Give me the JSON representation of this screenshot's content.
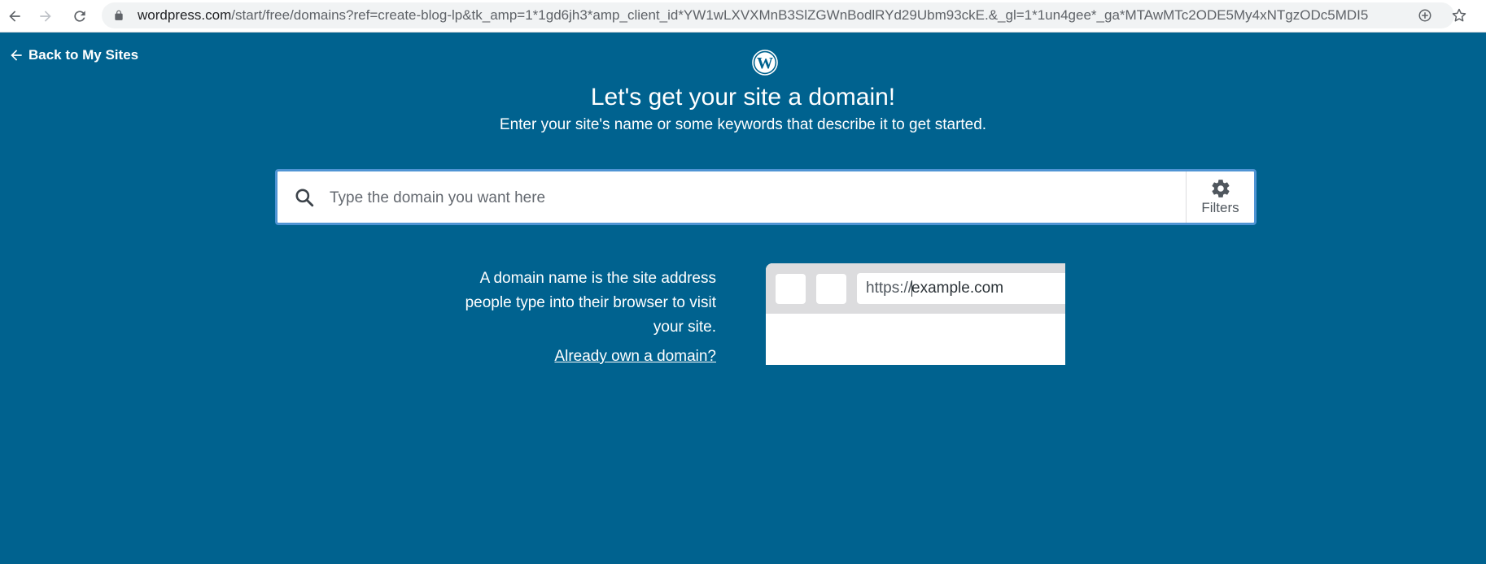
{
  "browser": {
    "url_host": "wordpress.com",
    "url_path": "/start/free/domains?ref=create-blog-lp&tk_amp=1*1gd6jh3*amp_client_id*YW1wLXVXMnB3SlZGWnBodlRYd29Ubm93ckE.&_gl=1*1un4gee*_ga*MTAwMTc2ODE5My4xNTgzODc5MDI5",
    "icons": [
      "back-arrow-icon",
      "forward-arrow-icon",
      "reload-icon",
      "lock-icon",
      "zoom-icon",
      "star-icon"
    ]
  },
  "header": {
    "back_label": "Back to My Sites",
    "title": "Let's get your site a domain!",
    "subtitle": "Enter your site's name or some keywords that describe it to get started."
  },
  "search": {
    "placeholder": "Type the domain you want here",
    "value": "",
    "filters_label": "Filters"
  },
  "explainer": {
    "text": "A domain name is the site address people type into their browser to visit your site.",
    "link_label": "Already own a domain?",
    "illustration_prefix": "https://",
    "illustration_domain": "example.com"
  },
  "colors": {
    "background": "#00628f",
    "search_border": "#4f94d4",
    "text": "#ffffff"
  }
}
